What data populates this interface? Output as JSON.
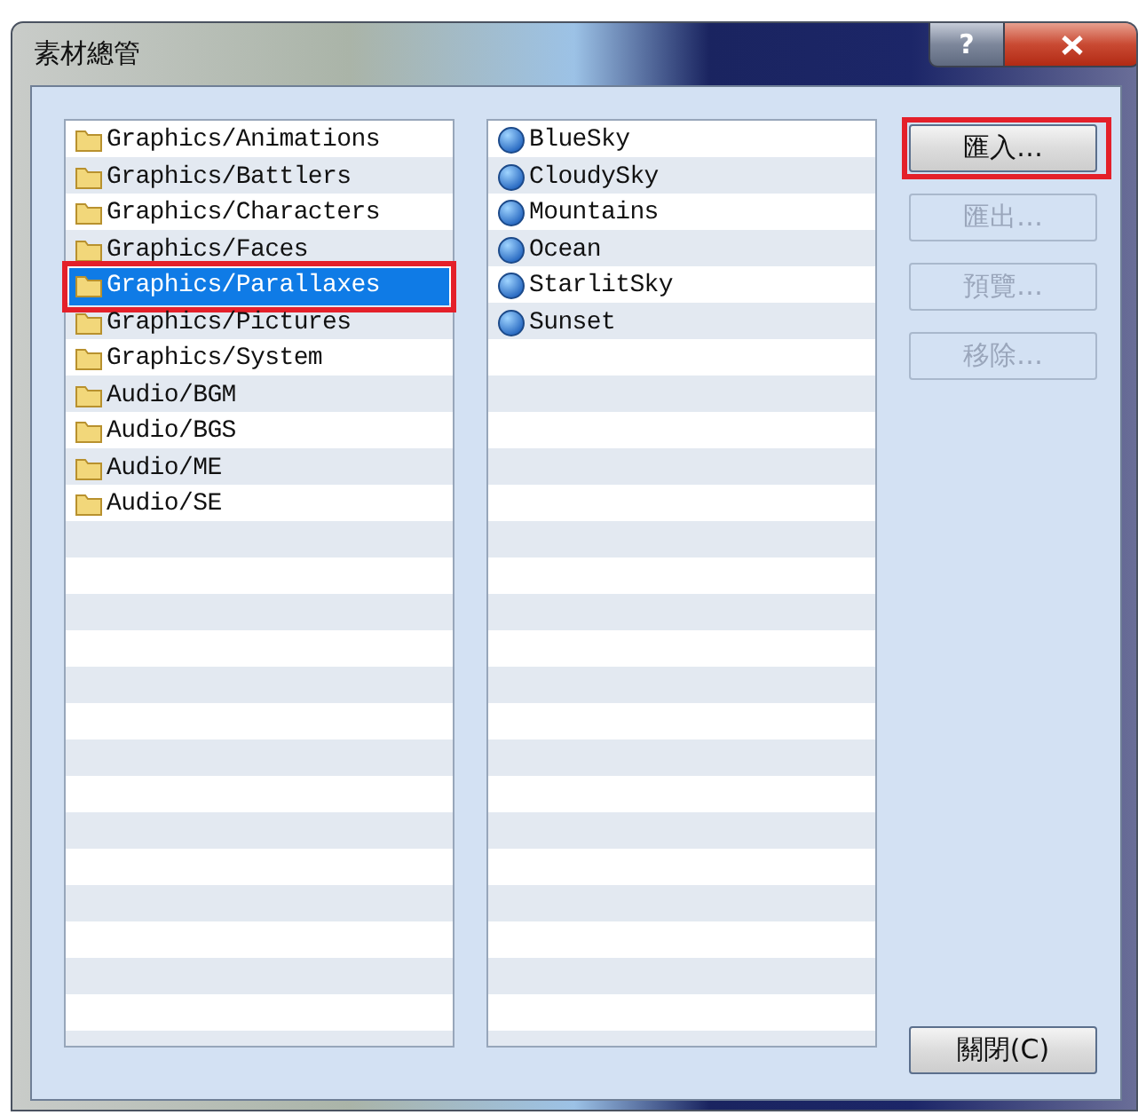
{
  "window": {
    "title": "素材總管",
    "help_button": "?"
  },
  "folders": [
    {
      "label": "Graphics/Animations",
      "selected": false,
      "highlighted": false
    },
    {
      "label": "Graphics/Battlers",
      "selected": false,
      "highlighted": false
    },
    {
      "label": "Graphics/Characters",
      "selected": false,
      "highlighted": false
    },
    {
      "label": "Graphics/Faces",
      "selected": false,
      "highlighted": false
    },
    {
      "label": "Graphics/Parallaxes",
      "selected": true,
      "highlighted": true
    },
    {
      "label": "Graphics/Pictures",
      "selected": false,
      "highlighted": false
    },
    {
      "label": "Graphics/System",
      "selected": false,
      "highlighted": false
    },
    {
      "label": "Audio/BGM",
      "selected": false,
      "highlighted": false
    },
    {
      "label": "Audio/BGS",
      "selected": false,
      "highlighted": false
    },
    {
      "label": "Audio/ME",
      "selected": false,
      "highlighted": false
    },
    {
      "label": "Audio/SE",
      "selected": false,
      "highlighted": false
    }
  ],
  "files": [
    {
      "label": "BlueSky"
    },
    {
      "label": "CloudySky"
    },
    {
      "label": "Mountains"
    },
    {
      "label": "Ocean"
    },
    {
      "label": "StarlitSky"
    },
    {
      "label": "Sunset"
    }
  ],
  "buttons": [
    {
      "label": "匯入…",
      "disabled": false,
      "highlighted": true
    },
    {
      "label": "匯出…",
      "disabled": true,
      "highlighted": false
    },
    {
      "label": "預覽…",
      "disabled": true,
      "highlighted": false
    },
    {
      "label": "移除…",
      "disabled": true,
      "highlighted": false
    }
  ],
  "close_button": {
    "label": "關閉(C)"
  }
}
